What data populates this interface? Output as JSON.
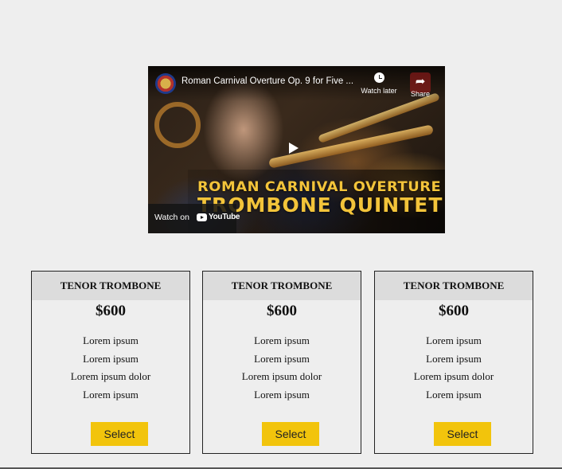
{
  "video": {
    "title": "Roman Carnival Overture Op. 9 for Five ...",
    "watch_later_label": "Watch later",
    "share_label": "Share",
    "overlay_line1": "ROMAN CARNIVAL OVERTURE",
    "overlay_line2": "TROMBONE QUINTET",
    "watch_on_label": "Watch on",
    "youtube_label": "YouTube"
  },
  "cards": [
    {
      "title": "TENOR TROMBONE",
      "price": "$600",
      "features": [
        "Lorem ipsum",
        "Lorem ipsum",
        "Lorem ipsum dolor",
        "Lorem ipsum"
      ],
      "button_label": "Select"
    },
    {
      "title": "TENOR TROMBONE",
      "price": "$600",
      "features": [
        "Lorem ipsum",
        "Lorem ipsum",
        "Lorem ipsum dolor",
        "Lorem ipsum"
      ],
      "button_label": "Select"
    },
    {
      "title": "TENOR TROMBONE",
      "price": "$600",
      "features": [
        "Lorem ipsum",
        "Lorem ipsum",
        "Lorem ipsum dolor",
        "Lorem ipsum"
      ],
      "button_label": "Select"
    }
  ],
  "colors": {
    "page_background": "#eeeeee",
    "card_header": "#dcdcdc",
    "button": "#f2c40c",
    "overlay_text": "#f3c43a"
  }
}
